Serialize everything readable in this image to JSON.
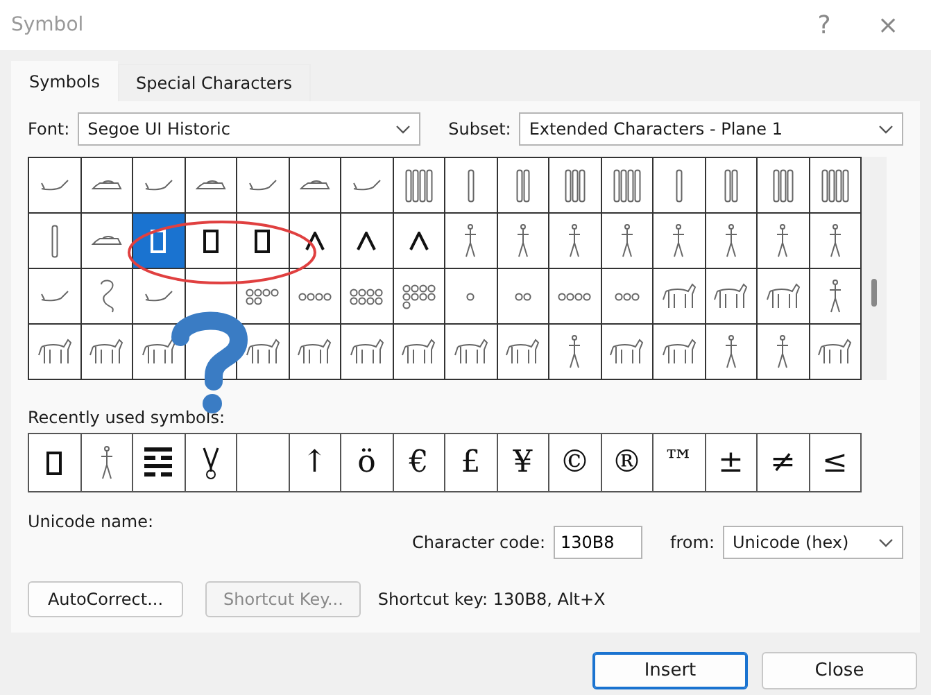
{
  "window": {
    "title": "Symbol",
    "help": "?",
    "close": "×"
  },
  "tabs": [
    {
      "label": "Symbols",
      "selected": true
    },
    {
      "label": "Special Characters",
      "selected": false
    }
  ],
  "font": {
    "label": "Font:",
    "value": "Segoe UI Historic"
  },
  "subset": {
    "label": "Subset:",
    "value": "Extended Characters - Plane 1"
  },
  "symbol_grid": {
    "cells": [
      {
        "kind": "lying",
        "selected": false
      },
      {
        "kind": "lying",
        "selected": false
      },
      {
        "kind": "lying",
        "selected": false
      },
      {
        "kind": "lying",
        "selected": false
      },
      {
        "kind": "lying",
        "selected": false
      },
      {
        "kind": "lying",
        "selected": false
      },
      {
        "kind": "lying",
        "selected": false
      },
      {
        "kind": "reed",
        "selected": false
      },
      {
        "kind": "reed",
        "selected": false
      },
      {
        "kind": "reed",
        "selected": false
      },
      {
        "kind": "reed",
        "selected": false
      },
      {
        "kind": "reed",
        "selected": false
      },
      {
        "kind": "reed",
        "selected": false
      },
      {
        "kind": "reed",
        "selected": false
      },
      {
        "kind": "reed",
        "selected": false
      },
      {
        "kind": "reed",
        "selected": false
      },
      {
        "kind": "reed",
        "selected": false
      },
      {
        "kind": "lying",
        "selected": false
      },
      {
        "kind": "box",
        "selected": true
      },
      {
        "kind": "box",
        "selected": false
      },
      {
        "kind": "box",
        "selected": false
      },
      {
        "kind": "wedge",
        "selected": false
      },
      {
        "kind": "wedge",
        "selected": false
      },
      {
        "kind": "wedge",
        "selected": false
      },
      {
        "kind": "figure",
        "selected": false
      },
      {
        "kind": "figure",
        "selected": false
      },
      {
        "kind": "figure",
        "selected": false
      },
      {
        "kind": "figure",
        "selected": false
      },
      {
        "kind": "figure",
        "selected": false
      },
      {
        "kind": "figure",
        "selected": false
      },
      {
        "kind": "figure",
        "selected": false
      },
      {
        "kind": "figure",
        "selected": false
      },
      {
        "kind": "lying",
        "selected": false
      },
      {
        "kind": "coil",
        "selected": false
      },
      {
        "kind": "lying",
        "selected": false
      },
      {
        "kind": "blank",
        "selected": false
      },
      {
        "kind": "dots",
        "selected": false
      },
      {
        "kind": "dots",
        "selected": false
      },
      {
        "kind": "dots",
        "selected": false
      },
      {
        "kind": "dots",
        "selected": false
      },
      {
        "kind": "dots",
        "selected": false
      },
      {
        "kind": "dots",
        "selected": false
      },
      {
        "kind": "dots",
        "selected": false
      },
      {
        "kind": "dots",
        "selected": false
      },
      {
        "kind": "animal",
        "selected": false
      },
      {
        "kind": "animal",
        "selected": false
      },
      {
        "kind": "animal",
        "selected": false
      },
      {
        "kind": "figure",
        "selected": false
      },
      {
        "kind": "animal",
        "selected": false
      },
      {
        "kind": "animal",
        "selected": false
      },
      {
        "kind": "animal",
        "selected": false
      },
      {
        "kind": "blank",
        "selected": false
      },
      {
        "kind": "animal",
        "selected": false
      },
      {
        "kind": "animal",
        "selected": false
      },
      {
        "kind": "animal",
        "selected": false
      },
      {
        "kind": "animal",
        "selected": false
      },
      {
        "kind": "animal",
        "selected": false
      },
      {
        "kind": "animal",
        "selected": false
      },
      {
        "kind": "figure",
        "selected": false
      },
      {
        "kind": "animal",
        "selected": false
      },
      {
        "kind": "animal",
        "selected": false
      },
      {
        "kind": "figure",
        "selected": false
      },
      {
        "kind": "figure",
        "selected": false
      },
      {
        "kind": "animal",
        "selected": false
      }
    ]
  },
  "recently_used": {
    "label": "Recently used symbols:",
    "items": [
      {
        "kind": "box"
      },
      {
        "kind": "figure"
      },
      {
        "kind": "bars"
      },
      {
        "kind": "hook"
      },
      {
        "kind": "blank"
      },
      {
        "kind": "char",
        "text": "↑"
      },
      {
        "kind": "char",
        "text": "ö"
      },
      {
        "kind": "char",
        "text": "€"
      },
      {
        "kind": "char",
        "text": "£"
      },
      {
        "kind": "char",
        "text": "¥"
      },
      {
        "kind": "char",
        "text": "©"
      },
      {
        "kind": "char",
        "text": "®"
      },
      {
        "kind": "char",
        "text": "™"
      },
      {
        "kind": "char",
        "text": "±"
      },
      {
        "kind": "char",
        "text": "≠"
      },
      {
        "kind": "char",
        "text": "≤"
      }
    ]
  },
  "unicode_name": {
    "label": "Unicode name:"
  },
  "character_code": {
    "label": "Character code:",
    "value": "130B8"
  },
  "from": {
    "label": "from:",
    "value": "Unicode (hex)"
  },
  "buttons": [
    {
      "label": "AutoCorrect...",
      "disabled": false
    },
    {
      "label": "Shortcut Key...",
      "disabled": true
    }
  ],
  "shortcut_key": "Shortcut key: 130B8, Alt+X",
  "footer_buttons": [
    {
      "label": "Insert",
      "default": true
    },
    {
      "label": "Close",
      "default": false
    }
  ]
}
